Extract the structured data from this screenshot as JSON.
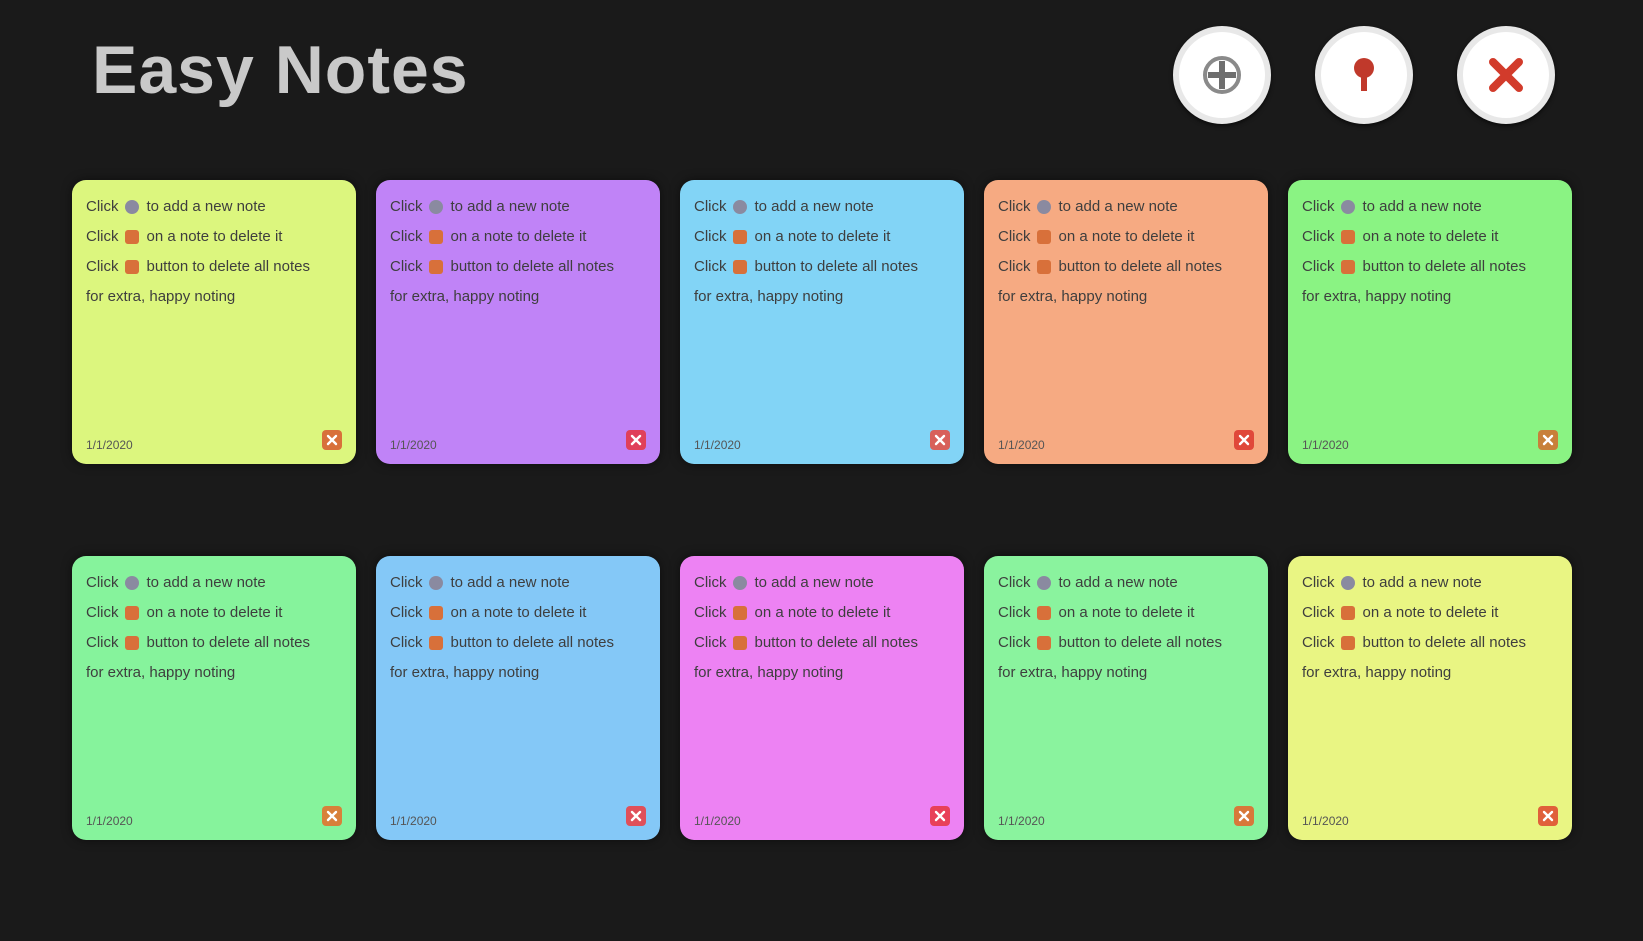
{
  "app": {
    "title": "Easy Notes"
  },
  "toolbar": {
    "buttons": [
      {
        "id": "add",
        "icon": "plus-icon",
        "color": "#6e6e6e"
      },
      {
        "id": "pin",
        "icon": "pin-icon",
        "color": "#c0392b"
      },
      {
        "id": "close",
        "icon": "close-icon",
        "color": "#d23b2b"
      }
    ]
  },
  "note_text": {
    "line1_pre": "Click",
    "line1_post": "to add a new note",
    "line2_pre": "Click",
    "line2_post": "on a note to delete it",
    "line3_pre": "Click",
    "line3_post": "button to delete all notes",
    "line4": "for extra, happy noting",
    "date": "1/1/2020"
  },
  "notes": [
    {
      "bg": "#dcf67e",
      "accent": "#d8703a"
    },
    {
      "bg": "#c083f7",
      "accent": "#e0405a"
    },
    {
      "bg": "#82d4f6",
      "accent": "#d8605a"
    },
    {
      "bg": "#f6aa82",
      "accent": "#e0483a"
    },
    {
      "bg": "#8af383",
      "accent": "#c8803a"
    },
    {
      "bg": "#86f39c",
      "accent": "#d8803a"
    },
    {
      "bg": "#84c8f7",
      "accent": "#e0505a"
    },
    {
      "bg": "#ed82f3",
      "accent": "#e84058"
    },
    {
      "bg": "#8af39e",
      "accent": "#d8783a"
    },
    {
      "bg": "#e9f583",
      "accent": "#e0603a"
    }
  ]
}
